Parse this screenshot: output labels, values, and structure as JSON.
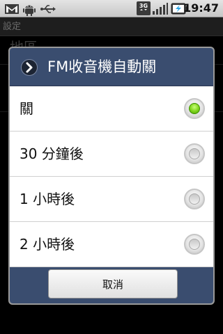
{
  "status_bar": {
    "icons": [
      "gmail-icon",
      "android-debug-icon",
      "usb-icon",
      "3g-icon",
      "signal-icon",
      "battery-charging-icon"
    ],
    "network_label": "3G",
    "time": "19:47"
  },
  "background": {
    "title": "設定",
    "first_item": "地區"
  },
  "dialog": {
    "title": "FM收音機自動關",
    "header_icon": "chevron-right-icon",
    "options": [
      {
        "label": "關",
        "selected": true
      },
      {
        "label": "30 分鐘後",
        "selected": false
      },
      {
        "label": "1 小時後",
        "selected": false
      },
      {
        "label": "2 小時後",
        "selected": false
      }
    ],
    "cancel_label": "取消"
  },
  "colors": {
    "dialog_header": "#3a4d6f",
    "selected_radio": "#6cc516",
    "status_bar": "#d6d6d6"
  }
}
